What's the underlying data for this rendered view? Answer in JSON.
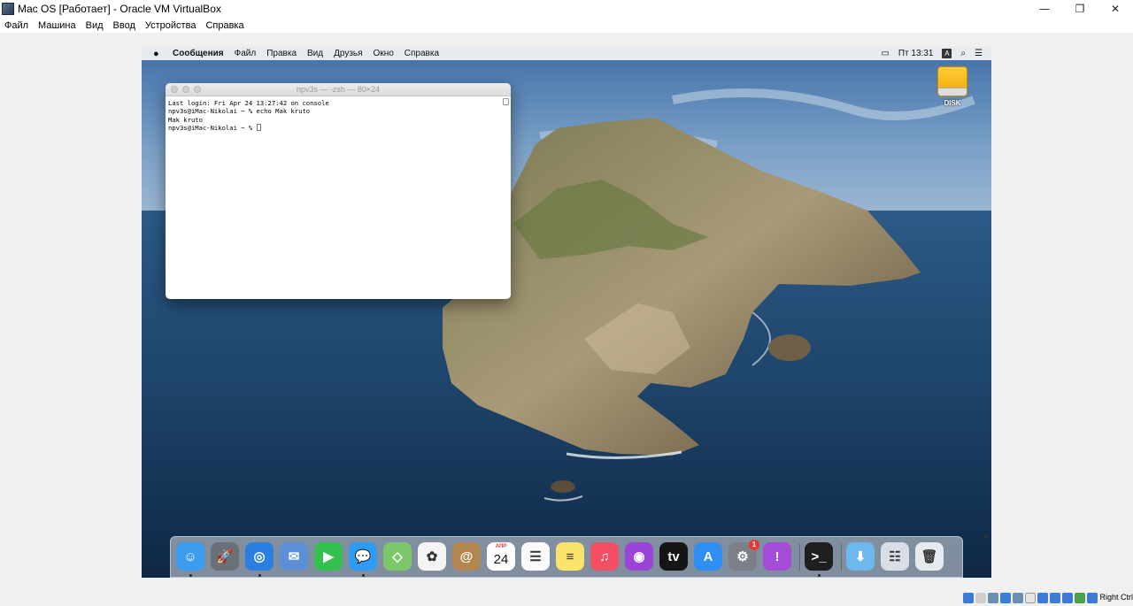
{
  "host": {
    "title": "Mac OS [Работает] - Oracle VM VirtualBox",
    "controls": {
      "minimize": "—",
      "restore": "❐",
      "close": "✕"
    },
    "menu": [
      "Файл",
      "Машина",
      "Вид",
      "Ввод",
      "Устройства",
      "Справка"
    ],
    "status": {
      "host_key": "Right Ctrl"
    }
  },
  "guest": {
    "menubar": {
      "app": "Сообщения",
      "items": [
        "Файл",
        "Правка",
        "Вид",
        "Друзья",
        "Окно",
        "Справка"
      ],
      "clock": "Пт 13:31",
      "input_source": "A"
    },
    "desktop": {
      "disk_label": "DISK"
    },
    "terminal": {
      "title": "npv3s — -zsh — 80×24",
      "lines": [
        "Last login: Fri Apr 24 13:27:42 on console",
        "npv3s@iMac-Nikolai ~ % echo Mak kruto",
        "Mak kruto",
        "npv3s@iMac-Nikolai ~ % "
      ]
    },
    "dock": {
      "apps": [
        {
          "name": "finder-icon",
          "glyph": "☺",
          "color": "#3c9cf0",
          "running": true
        },
        {
          "name": "launchpad-icon",
          "glyph": "🚀",
          "color": "#6b6f76",
          "running": false
        },
        {
          "name": "safari-icon",
          "glyph": "◎",
          "color": "#2a7fe0",
          "running": true
        },
        {
          "name": "mail-icon",
          "glyph": "✉",
          "color": "#5c8fd6",
          "running": false
        },
        {
          "name": "facetime-icon",
          "glyph": "▶",
          "color": "#33c14e",
          "running": false
        },
        {
          "name": "messages-icon",
          "glyph": "💬",
          "color": "#2f9bf3",
          "running": true
        },
        {
          "name": "maps-icon",
          "glyph": "◇",
          "color": "#7cc76a",
          "running": false
        },
        {
          "name": "photos-icon",
          "glyph": "✿",
          "color": "#f4f4f4",
          "running": false
        },
        {
          "name": "contacts-icon",
          "glyph": "@",
          "color": "#b2874f",
          "running": false
        },
        {
          "name": "calendar-icon",
          "glyph": "24",
          "month": "АПР",
          "color": "#ffffff",
          "running": false
        },
        {
          "name": "reminders-icon",
          "glyph": "☰",
          "color": "#fafafa",
          "running": false
        },
        {
          "name": "notes-icon",
          "glyph": "≡",
          "color": "#fbe36b",
          "running": false
        },
        {
          "name": "music-icon",
          "glyph": "♫",
          "color": "#f54d64",
          "running": false
        },
        {
          "name": "podcasts-icon",
          "glyph": "◉",
          "color": "#9b45d8",
          "running": false
        },
        {
          "name": "tv-icon",
          "glyph": "tv",
          "color": "#151515",
          "running": false
        },
        {
          "name": "app-store-icon",
          "glyph": "A",
          "color": "#2e8ef2",
          "running": false
        },
        {
          "name": "system-preferences-icon",
          "glyph": "⚙",
          "color": "#7b7f86",
          "running": false,
          "badge": "1"
        },
        {
          "name": "feedback-icon",
          "glyph": "!",
          "color": "#a44bd8",
          "running": false
        },
        {
          "name": "terminal-icon",
          "glyph": ">_",
          "color": "#1f1f1f",
          "running": true
        },
        {
          "name": "downloads-icon",
          "glyph": "⬇",
          "color": "#6db8ec",
          "running": false
        },
        {
          "name": "recents-stack-icon",
          "glyph": "☷",
          "color": "#d9dee6",
          "running": false
        },
        {
          "name": "trash-icon",
          "glyph": "🗑",
          "color": "#e6e9ee",
          "running": false
        }
      ]
    }
  }
}
